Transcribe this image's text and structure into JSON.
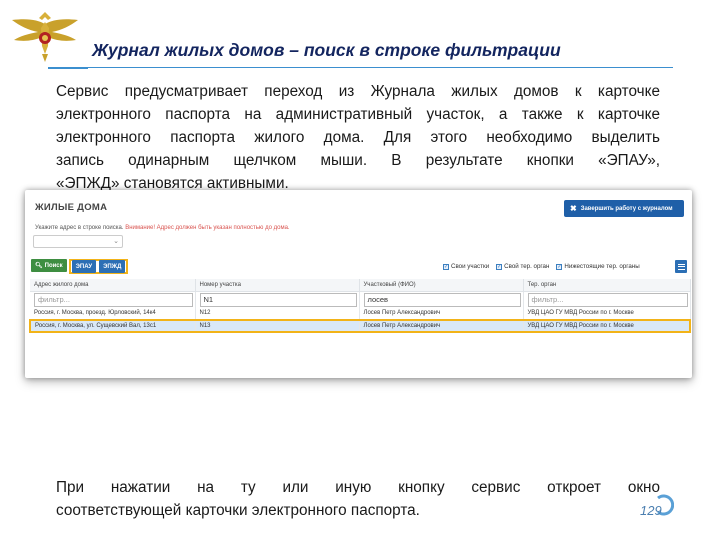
{
  "slide": {
    "title": "Журнал жилых домов – поиск в строке фильтрации",
    "intro_lines": [
      "Сервис предусматривает переход из Журнала жилых домов к карточке",
      "электронного паспорта на административный участок, а также к карточке",
      "электронного паспорта жилого дома. Для этого необходимо выделить",
      "запись одинарным щелчком мыши. В результате кнопки «ЭПАУ»,",
      "«ЭПЖД» становятся активными."
    ],
    "outro_lines": [
      "При нажатии на ту или иную кнопку сервис откроет окно",
      "соответствующей карточки электронного паспорта."
    ],
    "page_number": "129",
    "emblem_icon": "police-eagle-emblem-icon"
  },
  "screen": {
    "title": "ЖИЛЫЕ ДОМА",
    "finish_button": "Завершить работу с журналом",
    "hint_prefix": "Укажите адрес в строке поиска.",
    "hint_warning": "Внимание! Адрес должен быть указан полностью до дома.",
    "toolbar": {
      "search": "Поиск",
      "epau": "ЭПАУ",
      "epzhd": "ЭПЖД"
    },
    "checkboxes": [
      {
        "label": "Свои участки",
        "checked": true
      },
      {
        "label": "Свой тер. орган",
        "checked": true
      },
      {
        "label": "Нижестоящие тер. органы",
        "checked": true
      }
    ],
    "columns": [
      "Адрес жилого дома",
      "Номер участка",
      "Участковый (ФИО)",
      "Тер. орган"
    ],
    "filters": [
      {
        "value": "",
        "placeholder": "фильтр..."
      },
      {
        "value": "N1",
        "placeholder": ""
      },
      {
        "value": "лосев",
        "placeholder": ""
      },
      {
        "value": "",
        "placeholder": "фильтр..."
      }
    ],
    "rows": [
      {
        "address": "Россия, г. Москва, проезд. Юрловский, 14к4",
        "district": "N12",
        "officer": "Лосев Петр Александрович",
        "organ": "УВД ЦАО ГУ МВД России по г. Москве",
        "selected": false
      },
      {
        "address": "Россия, г. Москва, ул. Сущевский Вал, 13с1",
        "district": "N13",
        "officer": "Лосев Петр Александрович",
        "organ": "УВД ЦАО ГУ МВД России по г. Москве",
        "selected": true
      }
    ],
    "colors": {
      "primary": "#1f5fa8",
      "highlight": "#f2b318",
      "search_button": "#3e8e41",
      "warning": "#d9534f"
    }
  }
}
